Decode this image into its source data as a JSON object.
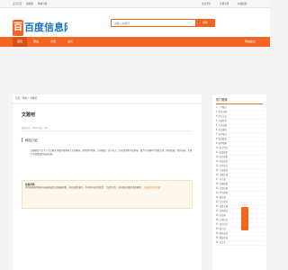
{
  "topbar": {
    "left_items": [
      "设为首页",
      "加收藏",
      "网站导航"
    ],
    "right_items": [
      "会员登录",
      "免费注册",
      "在线投稿"
    ]
  },
  "header": {
    "logo_badge": "百",
    "logo_text": "百度信息网"
  },
  "search": {
    "placeholder": "请输入关键词",
    "button_label": "搜索"
  },
  "nav": {
    "items": [
      "首页",
      "网站",
      "文章",
      "站长"
    ],
    "right_label": "网站提交"
  },
  "breadcrumb": "首页 > 网站 > 文雅吧",
  "main": {
    "title": "文雅吧",
    "meta": "更新时间：2024  浏览：127",
    "section_title": "网站介绍",
    "intro": "文雅吧是专注于广大古典文学爱好者的网上文化家园，提供国学经典、诗词歌赋、名人名言、历史故事等丰富内容，致力于传播中华传统文化，陶冶情操，提升修养，为用户营造雅致的阅读氛围。",
    "notice_title": "免责声明：",
    "notice_text": "本页面收录的网站内容由网友提交或网络收集，本站仅提供展示，不对其内容的真实性、合法性负责，如有侵权请联系我们删除。",
    "notice_link": "点击此处提交申诉"
  },
  "sidebar": {
    "title": "热门推荐",
    "items": [
      "一个酷站",
      "青年文摘",
      "作文大全",
      "诗词名句",
      "古诗文网",
      "美文摘抄",
      "读书笔记",
      "散文精选",
      "国学经典",
      "名言警句",
      "成语故事",
      "历史故事",
      "书法欣赏",
      "文学杂志",
      "小说阅读",
      "诗歌在线",
      "句子迷",
      "哲理故事",
      "汉语词典",
      "学习资料",
      "散文吧",
      "文艺青年",
      "读者文摘",
      "百科知识",
      "美文网",
      "心情日记",
      "短句大全",
      "微小说",
      "唐诗宋词",
      "网址导航",
      "文言文"
    ]
  }
}
